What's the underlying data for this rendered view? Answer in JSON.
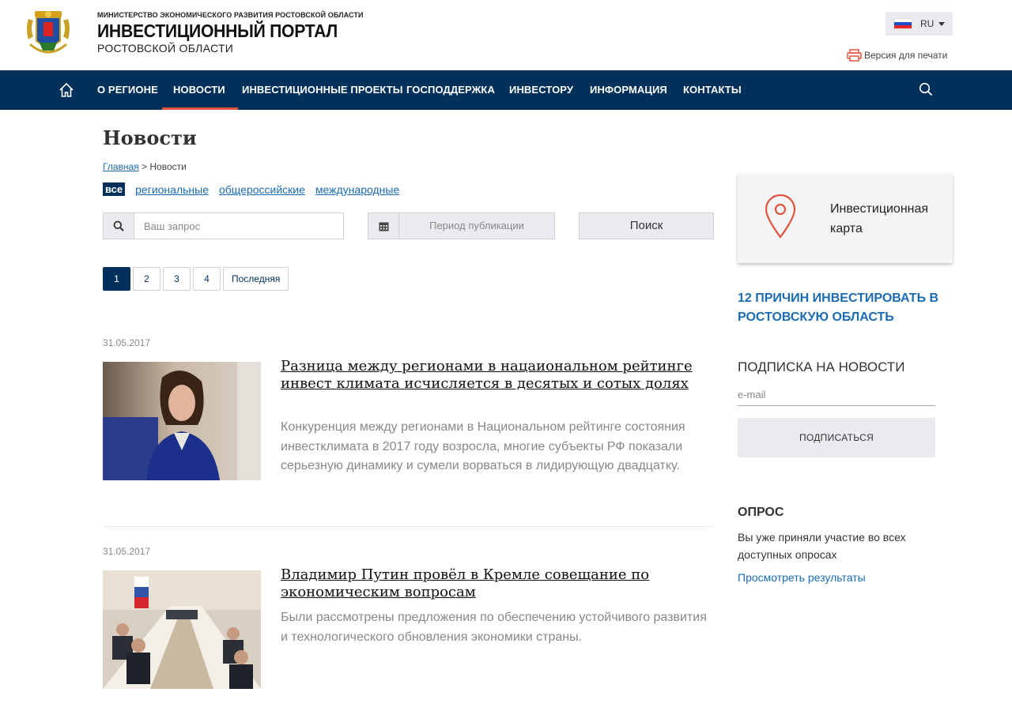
{
  "header": {
    "ministry": "МИНИСТЕРСТВО ЭКОНОМИЧЕСКОГО РАЗВИТИЯ РОСТОВСКОЙ ОБЛАСТИ",
    "title": "ИНВЕСТИЦИОННЫЙ ПОРТАЛ",
    "subtitle": "РОСТОВСКОЙ ОБЛАСТИ",
    "lang": "RU",
    "print_label": "Версия для печати"
  },
  "nav": {
    "items": [
      "О РЕГИОНЕ",
      "НОВОСТИ",
      "ИНВЕСТИЦИОННЫЕ ПРОЕКТЫ",
      "ГОСПОДДЕРЖКА",
      "ИНВЕСТОРУ",
      "ИНФОРМАЦИЯ",
      "КОНТАКТЫ"
    ],
    "active": "НОВОСТИ"
  },
  "page": {
    "title": "Новости",
    "breadcrumb_home": "Главная",
    "breadcrumb_sep": ">",
    "breadcrumb_current": "Новости"
  },
  "filters": {
    "all": "все",
    "items": [
      "региональные",
      "общероссийские",
      "международные"
    ]
  },
  "search": {
    "placeholder": "Ваш запрос",
    "period": "Период публикации",
    "button": "Поиск"
  },
  "pager": [
    "1",
    "2",
    "3",
    "4",
    "Последняя"
  ],
  "news": [
    {
      "date": "31.05.2017",
      "title": "Разница между регионами в нацаиональном рейтинге инвест климата исчисляется в десятых и сотых долях",
      "text": "Конкуренция между регионами в Национальном рейтинге состояния инвестклимата в 2017 году возросла, многие субъекты РФ показали серьезную динамику и сумели ворваться в лидирующую двадцатку."
    },
    {
      "date": "31.05.2017",
      "title": "Владимир Путин провёл в Кремле совещание по экономическим вопросам",
      "text": "Были рассмотрены предложения по обеспечению устойчивого развития и технологического обновления экономики страны."
    }
  ],
  "sidebar": {
    "map_label": "Инвестиционная карта",
    "reasons": "12 ПРИЧИН ИНВЕСТИРОВАТЬ В РОСТОВСКУЮ ОБЛАСТЬ",
    "subscribe_title": "ПОДПИСКА НА НОВОСТИ",
    "email_placeholder": "e-mail",
    "subscribe_button": "ПОДПИСАТЬСЯ",
    "poll_title": "ОПРОС",
    "poll_text": "Вы уже приняли участие во всех доступных опросах",
    "poll_link": "Просмотреть результаты"
  },
  "colors": {
    "nav_bg": "#01305a",
    "accent": "#e0533a",
    "link": "#1b6bb3"
  }
}
